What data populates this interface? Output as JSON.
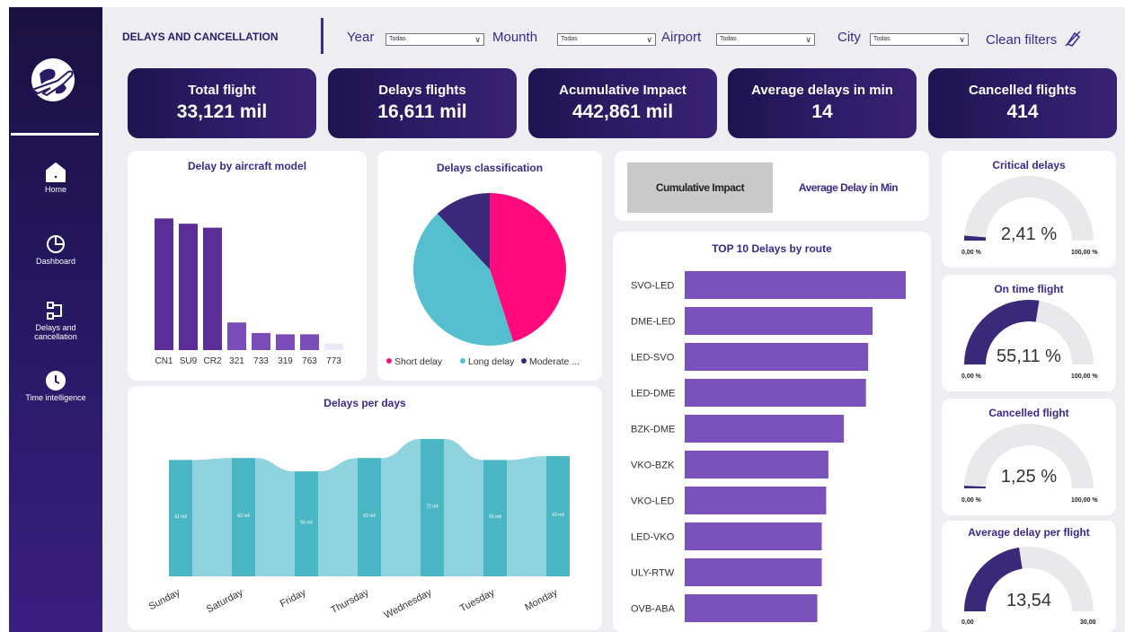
{
  "sidebar": {
    "items": [
      {
        "label": "Home",
        "icon": "home-icon"
      },
      {
        "label": "Dashboard",
        "icon": "pie-chart-icon"
      },
      {
        "label": "Delays and cancellation",
        "icon": "flow-icon"
      },
      {
        "label": "Time intelligence",
        "icon": "clock-icon"
      }
    ]
  },
  "header": {
    "title": "DELAYS AND CANCELLATION",
    "filters": [
      {
        "label": "Year",
        "value": "Todas"
      },
      {
        "label": "Mounth",
        "value": "Todas"
      },
      {
        "label": "Airport",
        "value": "Todas"
      },
      {
        "label": "City",
        "value": "Todas"
      }
    ],
    "clean_filters": "Clean filters"
  },
  "kpis": [
    {
      "title": "Total flight",
      "value": "33,121 mil"
    },
    {
      "title": "Delays flights",
      "value": "16,611 mil"
    },
    {
      "title": "Acumulative Impact",
      "value": "442,861 mil"
    },
    {
      "title": "Average delays in min",
      "value": "14"
    },
    {
      "title": "Cancelled flights",
      "value": "414"
    }
  ],
  "toggle": {
    "left": "Cumulative Impact",
    "right": "Average Delay in Min"
  },
  "colors": {
    "purple": "#5b2d99",
    "pink": "#ff0b7e",
    "teal": "#56bfcf",
    "navy": "#3a2878",
    "route_bar": "#7b52ba",
    "light_teal": "#8fd3de",
    "dark_teal": "#4bb6c4"
  },
  "chart_data": [
    {
      "type": "bar",
      "title": "Delay by aircraft model",
      "categories": [
        "CN1",
        "SU9",
        "CR2",
        "321",
        "733",
        "319",
        "763",
        "773"
      ],
      "values": [
        100,
        96,
        93,
        21,
        13,
        12,
        12,
        5
      ],
      "ylim": [
        0,
        105
      ]
    },
    {
      "type": "pie",
      "title": "Delays classification",
      "slices": [
        {
          "label": "Short delay",
          "value": 45
        },
        {
          "label": "Long delay",
          "value": 43
        },
        {
          "label": "Moderate ...",
          "value": 12
        }
      ]
    },
    {
      "type": "bar",
      "title": "TOP 10 Delays by route",
      "categories": [
        "SVO-LED",
        "DME-LED",
        "LED-SVO",
        "LED-DME",
        "BZK-DME",
        "VKO-BZK",
        "VKO-LED",
        "LED-VKO",
        "ULY-RTW",
        "OVB-ABA"
      ],
      "values": [
        100,
        85,
        83,
        82,
        72,
        65,
        64,
        62,
        62,
        60
      ],
      "xlim": [
        0,
        100
      ]
    },
    {
      "type": "bar",
      "title": "Delays per days",
      "categories": [
        "Sunday",
        "Saturday",
        "Friday",
        "Thursday",
        "Wednesday",
        "Tuesday",
        "Monday"
      ],
      "values": [
        61,
        62,
        55,
        62,
        72,
        61,
        63
      ],
      "data_labels": [
        "61 mil",
        "62 mil",
        "55 mil",
        "62 mil",
        "72 mil",
        "61 mil",
        "63 mil"
      ],
      "ylim": [
        0,
        80
      ]
    }
  ],
  "gauges": [
    {
      "title": "Critical delays",
      "value_text": "2,41 %",
      "fraction": 0.0241,
      "min": "0,00 %",
      "max": "100,00 %"
    },
    {
      "title": "On time flight",
      "value_text": "55,11 %",
      "fraction": 0.5511,
      "min": "0,00 %",
      "max": "100,00 %"
    },
    {
      "title": "Cancelled flight",
      "value_text": "1,25 %",
      "fraction": 0.0125,
      "min": "0,00 %",
      "max": "100,00 %"
    },
    {
      "title": "Average delay per flight",
      "value_text": "13,54",
      "fraction": 0.4513,
      "min": "0,00",
      "max": "30,00"
    }
  ]
}
